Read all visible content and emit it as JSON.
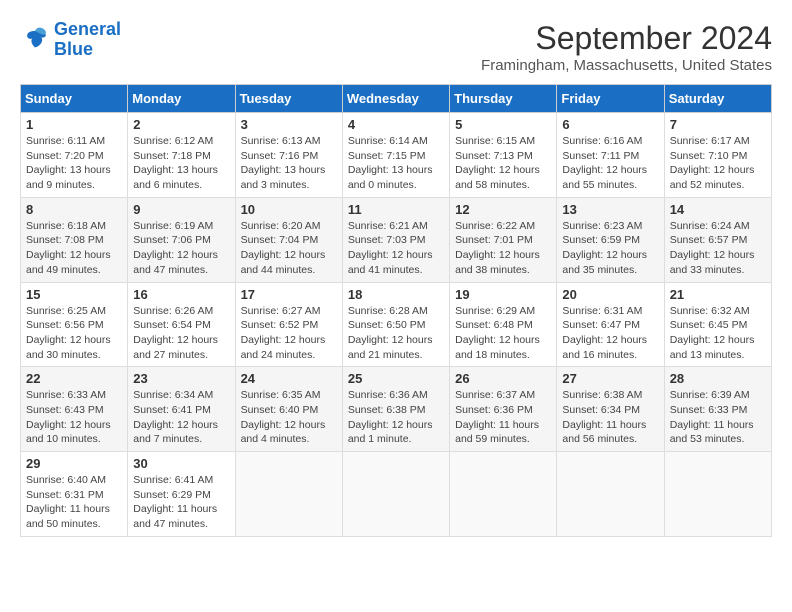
{
  "header": {
    "logo_line1": "General",
    "logo_line2": "Blue",
    "month_title": "September 2024",
    "location": "Framingham, Massachusetts, United States"
  },
  "days_of_week": [
    "Sunday",
    "Monday",
    "Tuesday",
    "Wednesday",
    "Thursday",
    "Friday",
    "Saturday"
  ],
  "weeks": [
    [
      {
        "day": "1",
        "sunrise": "6:11 AM",
        "sunset": "7:20 PM",
        "daylight": "13 hours and 9 minutes."
      },
      {
        "day": "2",
        "sunrise": "6:12 AM",
        "sunset": "7:18 PM",
        "daylight": "13 hours and 6 minutes."
      },
      {
        "day": "3",
        "sunrise": "6:13 AM",
        "sunset": "7:16 PM",
        "daylight": "13 hours and 3 minutes."
      },
      {
        "day": "4",
        "sunrise": "6:14 AM",
        "sunset": "7:15 PM",
        "daylight": "13 hours and 0 minutes."
      },
      {
        "day": "5",
        "sunrise": "6:15 AM",
        "sunset": "7:13 PM",
        "daylight": "12 hours and 58 minutes."
      },
      {
        "day": "6",
        "sunrise": "6:16 AM",
        "sunset": "7:11 PM",
        "daylight": "12 hours and 55 minutes."
      },
      {
        "day": "7",
        "sunrise": "6:17 AM",
        "sunset": "7:10 PM",
        "daylight": "12 hours and 52 minutes."
      }
    ],
    [
      {
        "day": "8",
        "sunrise": "6:18 AM",
        "sunset": "7:08 PM",
        "daylight": "12 hours and 49 minutes."
      },
      {
        "day": "9",
        "sunrise": "6:19 AM",
        "sunset": "7:06 PM",
        "daylight": "12 hours and 47 minutes."
      },
      {
        "day": "10",
        "sunrise": "6:20 AM",
        "sunset": "7:04 PM",
        "daylight": "12 hours and 44 minutes."
      },
      {
        "day": "11",
        "sunrise": "6:21 AM",
        "sunset": "7:03 PM",
        "daylight": "12 hours and 41 minutes."
      },
      {
        "day": "12",
        "sunrise": "6:22 AM",
        "sunset": "7:01 PM",
        "daylight": "12 hours and 38 minutes."
      },
      {
        "day": "13",
        "sunrise": "6:23 AM",
        "sunset": "6:59 PM",
        "daylight": "12 hours and 35 minutes."
      },
      {
        "day": "14",
        "sunrise": "6:24 AM",
        "sunset": "6:57 PM",
        "daylight": "12 hours and 33 minutes."
      }
    ],
    [
      {
        "day": "15",
        "sunrise": "6:25 AM",
        "sunset": "6:56 PM",
        "daylight": "12 hours and 30 minutes."
      },
      {
        "day": "16",
        "sunrise": "6:26 AM",
        "sunset": "6:54 PM",
        "daylight": "12 hours and 27 minutes."
      },
      {
        "day": "17",
        "sunrise": "6:27 AM",
        "sunset": "6:52 PM",
        "daylight": "12 hours and 24 minutes."
      },
      {
        "day": "18",
        "sunrise": "6:28 AM",
        "sunset": "6:50 PM",
        "daylight": "12 hours and 21 minutes."
      },
      {
        "day": "19",
        "sunrise": "6:29 AM",
        "sunset": "6:48 PM",
        "daylight": "12 hours and 18 minutes."
      },
      {
        "day": "20",
        "sunrise": "6:31 AM",
        "sunset": "6:47 PM",
        "daylight": "12 hours and 16 minutes."
      },
      {
        "day": "21",
        "sunrise": "6:32 AM",
        "sunset": "6:45 PM",
        "daylight": "12 hours and 13 minutes."
      }
    ],
    [
      {
        "day": "22",
        "sunrise": "6:33 AM",
        "sunset": "6:43 PM",
        "daylight": "12 hours and 10 minutes."
      },
      {
        "day": "23",
        "sunrise": "6:34 AM",
        "sunset": "6:41 PM",
        "daylight": "12 hours and 7 minutes."
      },
      {
        "day": "24",
        "sunrise": "6:35 AM",
        "sunset": "6:40 PM",
        "daylight": "12 hours and 4 minutes."
      },
      {
        "day": "25",
        "sunrise": "6:36 AM",
        "sunset": "6:38 PM",
        "daylight": "12 hours and 1 minute."
      },
      {
        "day": "26",
        "sunrise": "6:37 AM",
        "sunset": "6:36 PM",
        "daylight": "11 hours and 59 minutes."
      },
      {
        "day": "27",
        "sunrise": "6:38 AM",
        "sunset": "6:34 PM",
        "daylight": "11 hours and 56 minutes."
      },
      {
        "day": "28",
        "sunrise": "6:39 AM",
        "sunset": "6:33 PM",
        "daylight": "11 hours and 53 minutes."
      }
    ],
    [
      {
        "day": "29",
        "sunrise": "6:40 AM",
        "sunset": "6:31 PM",
        "daylight": "11 hours and 50 minutes."
      },
      {
        "day": "30",
        "sunrise": "6:41 AM",
        "sunset": "6:29 PM",
        "daylight": "11 hours and 47 minutes."
      },
      null,
      null,
      null,
      null,
      null
    ]
  ]
}
